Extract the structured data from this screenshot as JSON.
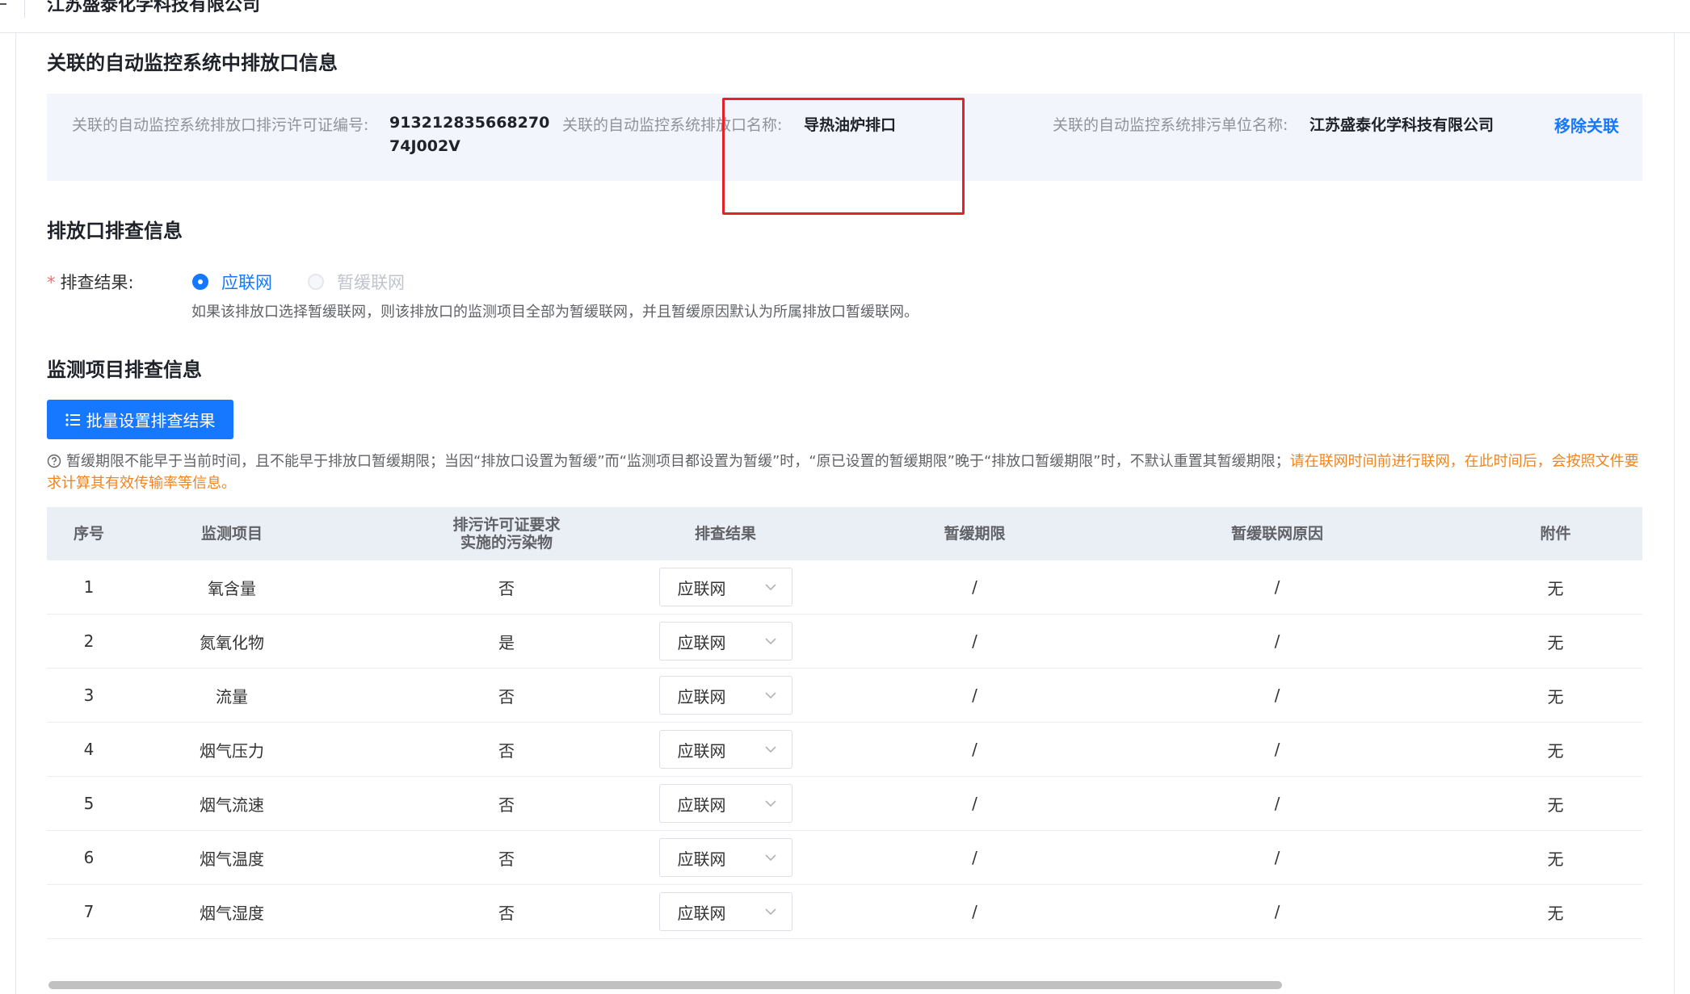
{
  "header": {
    "company_name": "江苏盛泰化学科技有限公司"
  },
  "linked_outlet": {
    "section_title": "关联的自动监控系统中排放口信息",
    "permit_label": "关联的自动监控系统排放口排污许可证编号:",
    "permit_value": "91321283566827074J002V",
    "name_label": "关联的自动监控系统排放口名称:",
    "name_value": "导热油炉排口",
    "unit_label": "关联的自动监控系统排污单位名称:",
    "unit_value": "江苏盛泰化学科技有限公司",
    "unlink_label": "移除关联"
  },
  "inspection": {
    "section_title": "排放口排查信息",
    "required_mark": "*",
    "result_label": "排查结果:",
    "options": [
      {
        "label": "应联网",
        "checked": true,
        "disabled": false
      },
      {
        "label": "暂缓联网",
        "checked": false,
        "disabled": true
      }
    ],
    "hint": "如果该排放口选择暂缓联网，则该排放口的监测项目全部为暂缓联网，并且暂缓原因默认为所属排放口暂缓联网。"
  },
  "monitoring": {
    "section_title": "监测项目排查信息",
    "batch_button_label": "批量设置排查结果",
    "notice_text": "暂缓期限不能早于当前时间，且不能早于排放口暂缓期限；当因“排放口设置为暂缓”而“监测项目都设置为暂缓”时，“原已设置的暂缓期限”晚于“排放口暂缓期限”时，不默认重置其暂缓期限；",
    "notice_warning": "请在联网时间前进行联网，在此时间后，会按照文件要求计算其有效传输率等信息。",
    "columns": [
      "序号",
      "监测项目",
      "排污许可证要求实施的污染物",
      "排查结果",
      "暂缓期限",
      "暂缓联网原因",
      "附件"
    ],
    "rows": [
      {
        "no": "1",
        "item": "氧含量",
        "required": "否",
        "result": "应联网",
        "deadline": "/",
        "reason": "/",
        "attachment": "无"
      },
      {
        "no": "2",
        "item": "氮氧化物",
        "required": "是",
        "result": "应联网",
        "deadline": "/",
        "reason": "/",
        "attachment": "无"
      },
      {
        "no": "3",
        "item": "流量",
        "required": "否",
        "result": "应联网",
        "deadline": "/",
        "reason": "/",
        "attachment": "无"
      },
      {
        "no": "4",
        "item": "烟气压力",
        "required": "否",
        "result": "应联网",
        "deadline": "/",
        "reason": "/",
        "attachment": "无"
      },
      {
        "no": "5",
        "item": "烟气流速",
        "required": "否",
        "result": "应联网",
        "deadline": "/",
        "reason": "/",
        "attachment": "无"
      },
      {
        "no": "6",
        "item": "烟气温度",
        "required": "否",
        "result": "应联网",
        "deadline": "/",
        "reason": "/",
        "attachment": "无"
      },
      {
        "no": "7",
        "item": "烟气湿度",
        "required": "否",
        "result": "应联网",
        "deadline": "/",
        "reason": "/",
        "attachment": "无"
      }
    ]
  },
  "colors": {
    "primary": "#1677ff",
    "warning": "#f0841e",
    "annotation": "#e5202b"
  }
}
